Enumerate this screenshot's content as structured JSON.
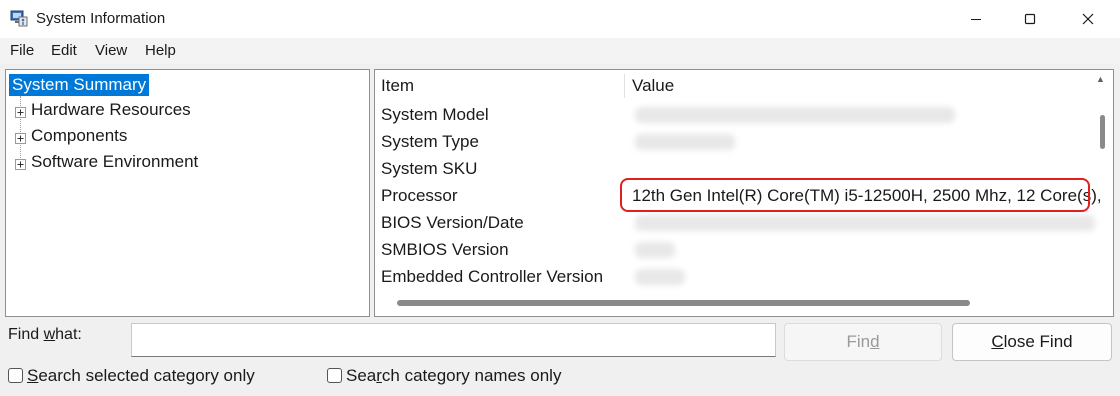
{
  "window": {
    "title": "System Information",
    "app_icon": "system-information-icon",
    "controls": [
      "minimize-icon",
      "maximize-icon",
      "close-icon"
    ]
  },
  "menu": {
    "items": [
      "File",
      "Edit",
      "View",
      "Help"
    ]
  },
  "tree": {
    "selected": "System Summary",
    "children": [
      "Hardware Resources",
      "Components",
      "Software Environment"
    ]
  },
  "details": {
    "columns": {
      "item": "Item",
      "value": "Value"
    },
    "rows": [
      {
        "item": "System Model"
      },
      {
        "item": "System Type"
      },
      {
        "item": "System SKU"
      },
      {
        "item": "Processor",
        "value": "12th Gen Intel(R) Core(TM) i5-12500H, 2500 Mhz, 12 Core(s),"
      },
      {
        "item": "BIOS Version/Date"
      },
      {
        "item": "SMBIOS Version"
      },
      {
        "item": "Embedded Controller Version"
      }
    ],
    "highlight_color": "#e02020"
  },
  "find_bar": {
    "label_prefix": "Find ",
    "label_accel": "w",
    "label_suffix": "hat:",
    "input_value": "",
    "find_button": {
      "prefix": "Fin",
      "accel": "d",
      "suffix": "",
      "enabled": false
    },
    "close_button": {
      "prefix": "",
      "accel": "C",
      "suffix": "lose Find"
    },
    "checkbox_selected_category": {
      "prefix": "",
      "accel": "S",
      "suffix": "earch selected category only",
      "checked": false
    },
    "checkbox_category_names": {
      "prefix": "Sea",
      "accel": "r",
      "suffix": "ch category names only",
      "checked": false
    }
  },
  "colors": {
    "selection": "#0078d7",
    "window_bg": "#f0f0f0"
  }
}
